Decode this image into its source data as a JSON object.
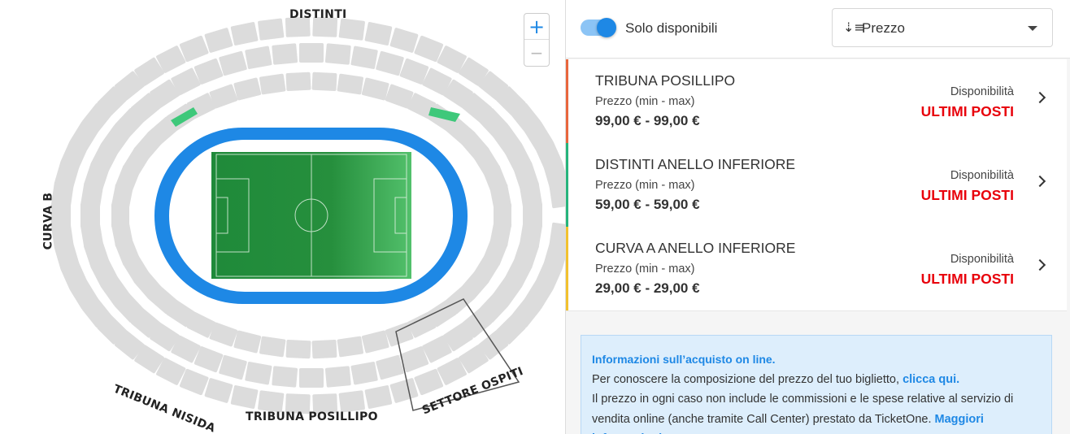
{
  "map": {
    "labels": {
      "distinti": "DISTINTI",
      "curva_b": "CURVA B",
      "tribuna_nisida": "TRIBUNA NISIDA",
      "tribuna_posillipo": "TRIBUNA POSILLIPO",
      "settore_ospiti": "SETTORE OSPITI"
    },
    "zoom_in": "+",
    "zoom_out": "−",
    "colors": {
      "seats": "#dcdcdc",
      "track": "#1e88e5",
      "pitch": "#1f8a3a",
      "available": "#3ec87a"
    }
  },
  "filters": {
    "toggle_label": "Solo disponibili",
    "toggle_on": true,
    "sort_icon": "sort-amount-icon",
    "sort_value": "Prezzo"
  },
  "sectors": [
    {
      "name": "TRIBUNA POSILLIPO",
      "price_label": "Prezzo (min - max)",
      "price": "99,00 € - 99,00 €",
      "avail_label": "Disponibilità",
      "avail": "ULTIMI POSTI",
      "color": "#e8663d"
    },
    {
      "name": "DISTINTI ANELLO INFERIORE",
      "price_label": "Prezzo (min - max)",
      "price": "59,00 € - 59,00 €",
      "avail_label": "Disponibilità",
      "avail": "ULTIMI POSTI",
      "color": "#26b47c"
    },
    {
      "name": "CURVA A ANELLO INFERIORE",
      "price_label": "Prezzo (min - max)",
      "price": "29,00 € - 29,00 €",
      "avail_label": "Disponibilità",
      "avail": "ULTIMI POSTI",
      "color": "#f2c12e"
    }
  ],
  "info": {
    "title": "Informazioni sull’acquisto on line.",
    "line1": "Per conoscere la composizione del prezzo del tuo biglietto,",
    "link1": "clicca qui.",
    "line2": "Il prezzo in ogni caso non include le commissioni e le spese relative al servizio di vendita online (anche tramite Call Center) prestato da TicketOne.",
    "link2": "Maggiori informazioni"
  }
}
